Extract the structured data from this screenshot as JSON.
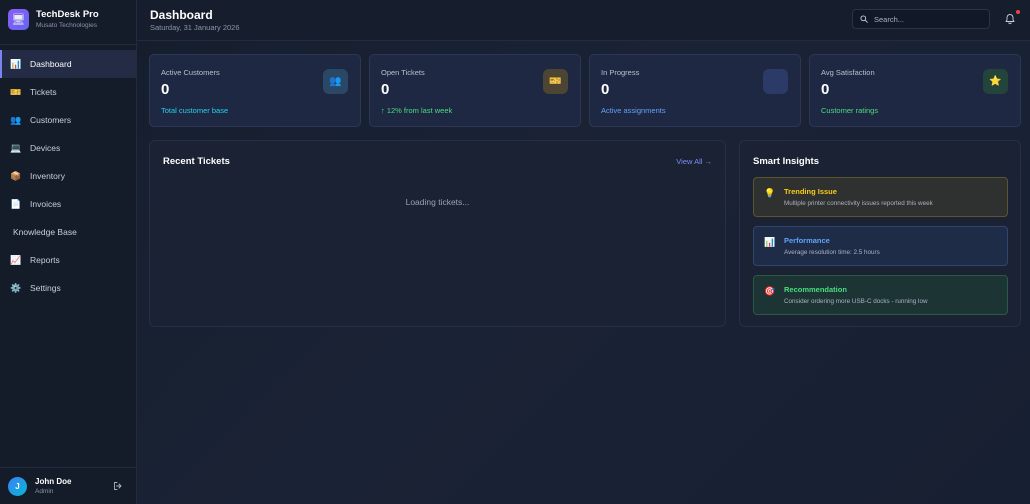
{
  "brand": {
    "name": "TechDesk Pro",
    "company": "Musato Technologies",
    "logo_icon": "desk-icon"
  },
  "nav": [
    {
      "label": "Dashboard",
      "icon": "📊",
      "active": true
    },
    {
      "label": "Tickets",
      "icon": "🎫"
    },
    {
      "label": "Customers",
      "icon": "👥"
    },
    {
      "label": "Devices",
      "icon": "💻"
    },
    {
      "label": "Inventory",
      "icon": "📦"
    },
    {
      "label": "Invoices",
      "icon": "📄"
    },
    {
      "label": "Knowledge Base",
      "icon": ""
    },
    {
      "label": "Reports",
      "icon": "📈"
    },
    {
      "label": "Settings",
      "icon": "⚙️"
    }
  ],
  "user": {
    "initial": "J",
    "name": "John Doe",
    "role": "Admin"
  },
  "header": {
    "title": "Dashboard",
    "date": "Saturday, 31 January 2026",
    "search_placeholder": "Search..."
  },
  "stats": [
    {
      "label": "Active Customers",
      "value": "0",
      "sub": "Total customer base",
      "sub_color": "#22d3ee",
      "icon": "👥",
      "icon_bg": "#2b4766"
    },
    {
      "label": "Open Tickets",
      "value": "0",
      "sub": "↑ 12% from last week",
      "sub_color": "#4ade80",
      "icon": "🎫",
      "icon_bg": "#4d4534"
    },
    {
      "label": "In Progress",
      "value": "0",
      "sub": "Active assignments",
      "sub_color": "#60a5fa",
      "icon": "",
      "icon_bg": "#2b3a66"
    },
    {
      "label": "Avg Satisfaction",
      "value": "0",
      "sub": "Customer ratings",
      "sub_color": "#4ade80",
      "icon": "⭐",
      "icon_bg": "#22443a"
    }
  ],
  "recent": {
    "title": "Recent Tickets",
    "view_all": "View All →",
    "loading": "Loading tickets..."
  },
  "insights": {
    "title": "Smart Insights",
    "items": [
      {
        "icon": "💡",
        "title": "Trending Issue",
        "desc": "Multiple printer connectivity issues reported this week",
        "title_color": "#facc15",
        "bg": "#2f3130",
        "border": "#5a5530"
      },
      {
        "icon": "📊",
        "title": "Performance",
        "desc": "Average resolution time: 2.5 hours",
        "title_color": "#60a5fa",
        "bg": "#1f2c47",
        "border": "#2e4570"
      },
      {
        "icon": "🎯",
        "title": "Recommendation",
        "desc": "Consider ordering more USB-C docks - running low",
        "title_color": "#4ade80",
        "bg": "#1c3433",
        "border": "#2a5a45"
      }
    ]
  }
}
